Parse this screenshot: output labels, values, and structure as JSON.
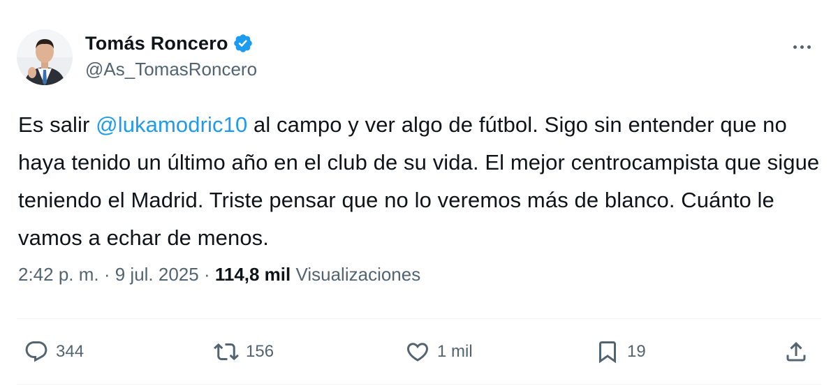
{
  "author": {
    "display_name": "Tomás Roncero",
    "handle": "@As_TomasRoncero",
    "verified": true
  },
  "tweet": {
    "text_before_mention": "Es salir ",
    "mention": "@lukamodric10",
    "text_after_mention": " al campo y ver algo de fútbol. Sigo sin entender que no haya tenido un último año en el club de su vida. El mejor centrocampista que sigue teniendo el Madrid. Triste pensar que no lo veremos más de blanco. Cuánto le vamos a echar de menos."
  },
  "meta": {
    "time": "2:42 p. m.",
    "separator": " · ",
    "date": "9 jul. 2025",
    "views_count": "114,8 mil",
    "views_label": "Visualizaciones"
  },
  "actions": {
    "replies": "344",
    "reposts": "156",
    "likes": "1 mil",
    "bookmarks": "19"
  },
  "icons": {
    "verified": "verified-badge-icon",
    "more": "more-icon",
    "reply": "reply-icon",
    "repost": "repost-icon",
    "like": "heart-icon",
    "bookmark": "bookmark-icon",
    "share": "share-icon"
  },
  "colors": {
    "text": "#0f1419",
    "secondary": "#536471",
    "accent": "#1d9bf0",
    "divider": "#eff3f4"
  }
}
